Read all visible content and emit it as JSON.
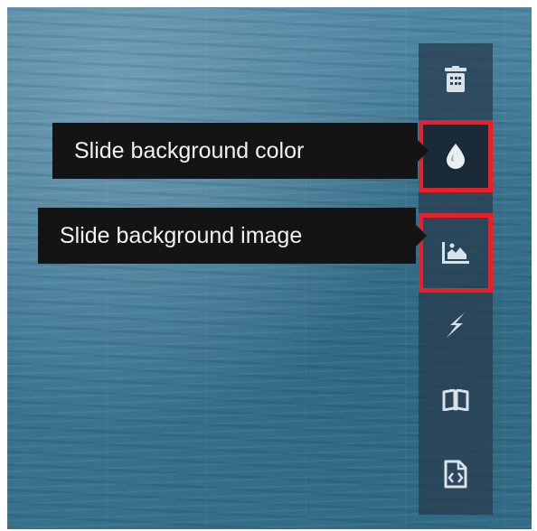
{
  "tooltips": {
    "color": "Slide background color",
    "image": "Slide background image"
  },
  "toolbar": {
    "buttons": [
      {
        "name": "delete",
        "icon": "trash-icon"
      },
      {
        "name": "background-color",
        "icon": "droplet-icon"
      },
      {
        "name": "background-image",
        "icon": "image-icon"
      },
      {
        "name": "animation",
        "icon": "lightning-icon"
      },
      {
        "name": "notes",
        "icon": "book-icon"
      },
      {
        "name": "html-code",
        "icon": "code-file-icon"
      }
    ]
  },
  "colors": {
    "toolbar_bg": "#283e50",
    "highlight": "#e8202a",
    "tooltip_bg": "#141414",
    "icon": "#d9e2e8"
  }
}
